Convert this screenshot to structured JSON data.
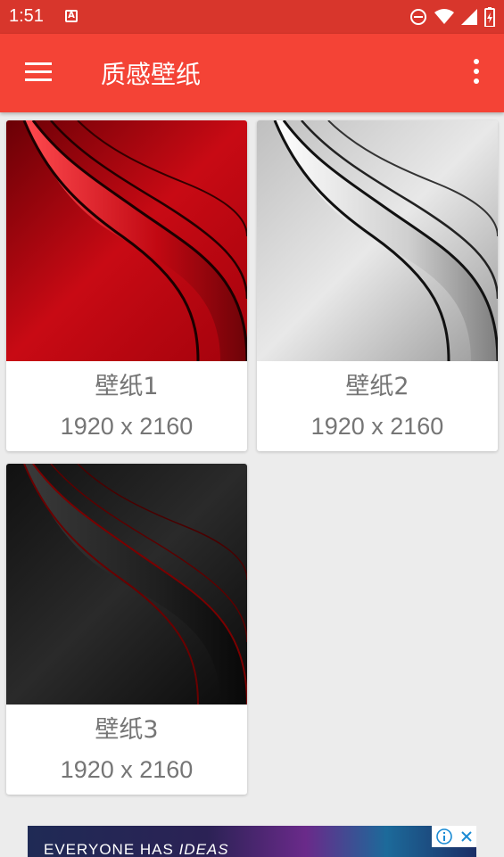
{
  "status_bar": {
    "time": "1:51",
    "notification_icon": "a-icon",
    "icons": [
      "do-not-disturb-icon",
      "wifi-icon",
      "signal-icon",
      "battery-icon"
    ]
  },
  "app_bar": {
    "title": "质感壁纸",
    "color": "#f44336"
  },
  "wallpapers": [
    {
      "name": "壁纸1",
      "size": "1920 x 2160",
      "theme": "red"
    },
    {
      "name": "壁纸2",
      "size": "1920 x 2160",
      "theme": "silver"
    },
    {
      "name": "壁纸3",
      "size": "1920 x 2160",
      "theme": "black"
    }
  ],
  "ad": {
    "text_prefix": "EVERYONE HAS ",
    "text_em": "IDEAS"
  }
}
